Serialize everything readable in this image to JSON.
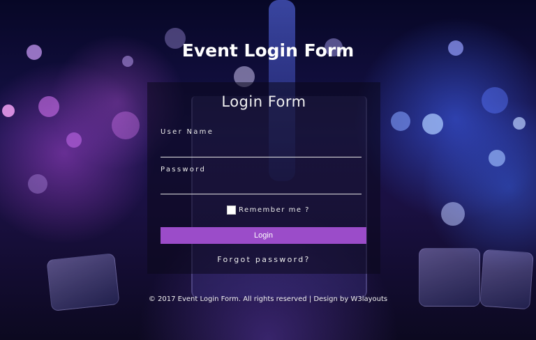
{
  "page": {
    "title": "Event Login Form"
  },
  "form": {
    "heading": "Login Form",
    "username_label": "User Name",
    "username_value": "",
    "password_label": "Password",
    "password_value": "",
    "remember_label": "Remember me ?",
    "remember_checked": false,
    "login_button_label": "Login",
    "forgot_password_label": "Forgot password?"
  },
  "footer": {
    "text": "© 2017 Event Login Form. All rights reserved | Design by W3layouts"
  },
  "colors": {
    "button": "#9b4cc9",
    "text": "#ffffff",
    "background_dark": "#0c0920",
    "bokeh_purple": "#b25ad6",
    "bokeh_blue": "#4a67e8"
  }
}
